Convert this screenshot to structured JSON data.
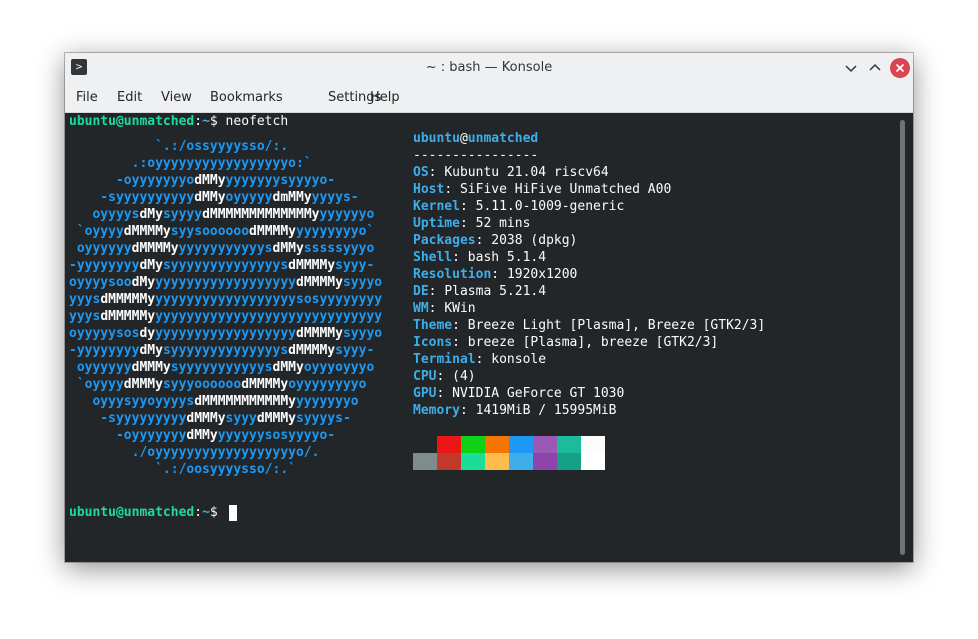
{
  "window": {
    "title": "~ : bash — Konsole",
    "app_icon": "terminal-icon",
    "controls": [
      "minimize-icon",
      "maximize-icon",
      "close-icon"
    ]
  },
  "menu": {
    "items": [
      {
        "label": "File"
      },
      {
        "label": "Edit"
      },
      {
        "label": "View"
      },
      {
        "label": "Bookmarks"
      },
      {
        "label": "Settings"
      },
      {
        "label": "Help"
      }
    ]
  },
  "terminal": {
    "prompt1": {
      "user_host": "ubuntu@unmatched",
      "sep": ":",
      "path": "~",
      "sigil": "$ ",
      "command": "neofetch"
    },
    "logo_lines": [
      [
        {
          "t": "           `.:/ossyyyysso/:.",
          "c": "b"
        }
      ],
      [
        {
          "t": "        .:oyyyyyyyyyyyyyyyyyo:`",
          "c": "b"
        }
      ],
      [
        {
          "t": "      -oyyyyyyyo",
          "c": "b"
        },
        {
          "t": "dMMy",
          "c": "w"
        },
        {
          "t": "yyyyyyysyyyyo-",
          "c": "b"
        }
      ],
      [
        {
          "t": "    -syyyyyyyyyy",
          "c": "b"
        },
        {
          "t": "dMMy",
          "c": "w"
        },
        {
          "t": "oyyyyy",
          "c": "b"
        },
        {
          "t": "dmMMy",
          "c": "w"
        },
        {
          "t": "yyyys-",
          "c": "b"
        }
      ],
      [
        {
          "t": "   oyyyys",
          "c": "b"
        },
        {
          "t": "dMy",
          "c": "w"
        },
        {
          "t": "syyyy",
          "c": "b"
        },
        {
          "t": "dMMMMMMMMMMMMMy",
          "c": "w"
        },
        {
          "t": "yyyyyyo",
          "c": "b"
        }
      ],
      [
        {
          "t": " `oyyyy",
          "c": "b"
        },
        {
          "t": "dMMMMy",
          "c": "w"
        },
        {
          "t": "syysoooooo",
          "c": "b"
        },
        {
          "t": "dMMMMy",
          "c": "w"
        },
        {
          "t": "yyyyyyyyo`",
          "c": "b"
        }
      ],
      [
        {
          "t": " oyyyyyy",
          "c": "b"
        },
        {
          "t": "dMMMMy",
          "c": "w"
        },
        {
          "t": "yyyyyyyyyyys",
          "c": "b"
        },
        {
          "t": "dMMy",
          "c": "w"
        },
        {
          "t": "sssssyyyo",
          "c": "b"
        }
      ],
      [
        {
          "t": "-yyyyyyyy",
          "c": "b"
        },
        {
          "t": "dMy",
          "c": "w"
        },
        {
          "t": "syyyyyyyyyyyyyys",
          "c": "b"
        },
        {
          "t": "dMMMMy",
          "c": "w"
        },
        {
          "t": "syyy-",
          "c": "b"
        }
      ],
      [
        {
          "t": "oyyyysoo",
          "c": "b"
        },
        {
          "t": "dMy",
          "c": "w"
        },
        {
          "t": "yyyyyyyyyyyyyyyyyy",
          "c": "b"
        },
        {
          "t": "dMMMMy",
          "c": "w"
        },
        {
          "t": "syyyo",
          "c": "b"
        }
      ],
      [
        {
          "t": "yyys",
          "c": "b"
        },
        {
          "t": "dMMMMMy",
          "c": "w"
        },
        {
          "t": "yyyyyyyyyyyyyyyyyysosyyyyyyyy",
          "c": "b"
        }
      ],
      [
        {
          "t": "yyys",
          "c": "b"
        },
        {
          "t": "dMMMMMy",
          "c": "w"
        },
        {
          "t": "yyyyyyyyyyyyyyyyyyyyyyyyyyyyy",
          "c": "b"
        }
      ],
      [
        {
          "t": "oyyyyysos",
          "c": "b"
        },
        {
          "t": "dy",
          "c": "w"
        },
        {
          "t": "yyyyyyyyyyyyyyyyyy",
          "c": "b"
        },
        {
          "t": "dMMMMy",
          "c": "w"
        },
        {
          "t": "syyyo",
          "c": "b"
        }
      ],
      [
        {
          "t": "-yyyyyyyy",
          "c": "b"
        },
        {
          "t": "dMy",
          "c": "w"
        },
        {
          "t": "syyyyyyyyyyyyyys",
          "c": "b"
        },
        {
          "t": "dMMMMy",
          "c": "w"
        },
        {
          "t": "syyy-",
          "c": "b"
        }
      ],
      [
        {
          "t": " oyyyyyy",
          "c": "b"
        },
        {
          "t": "dMMMy",
          "c": "w"
        },
        {
          "t": "syyyyyyyyyyys",
          "c": "b"
        },
        {
          "t": "dMMy",
          "c": "w"
        },
        {
          "t": "oyyyoyyyo",
          "c": "b"
        }
      ],
      [
        {
          "t": " `oyyyy",
          "c": "b"
        },
        {
          "t": "dMMMy",
          "c": "w"
        },
        {
          "t": "syyyoooooo",
          "c": "b"
        },
        {
          "t": "dMMMMy",
          "c": "w"
        },
        {
          "t": "oyyyyyyyyo",
          "c": "b"
        }
      ],
      [
        {
          "t": "   oyyysyyoyyyys",
          "c": "b"
        },
        {
          "t": "dMMMMMMMMMMMy",
          "c": "w"
        },
        {
          "t": "yyyyyyyo",
          "c": "b"
        }
      ],
      [
        {
          "t": "    -syyyyyyyyy",
          "c": "b"
        },
        {
          "t": "dMMMy",
          "c": "w"
        },
        {
          "t": "syyy",
          "c": "b"
        },
        {
          "t": "dMMMy",
          "c": "w"
        },
        {
          "t": "syyyys-",
          "c": "b"
        }
      ],
      [
        {
          "t": "      -oyyyyyyy",
          "c": "b"
        },
        {
          "t": "dMMy",
          "c": "w"
        },
        {
          "t": "yyyyyysosyyyyo-",
          "c": "b"
        }
      ],
      [
        {
          "t": "        ./oyyyyyyyyyyyyyyyyyyo/.",
          "c": "b"
        }
      ],
      [
        {
          "t": "           `.:/oosyyyysso/:.`",
          "c": "b"
        }
      ]
    ],
    "info": {
      "user": "ubuntu",
      "at": "@",
      "host": "unmatched",
      "separator": "----------------",
      "fields": [
        {
          "key": "OS",
          "value": "Kubuntu 21.04 riscv64"
        },
        {
          "key": "Host",
          "value": "SiFive HiFive Unmatched A00"
        },
        {
          "key": "Kernel",
          "value": "5.11.0-1009-generic"
        },
        {
          "key": "Uptime",
          "value": "52 mins"
        },
        {
          "key": "Packages",
          "value": "2038 (dpkg)"
        },
        {
          "key": "Shell",
          "value": "bash 5.1.4"
        },
        {
          "key": "Resolution",
          "value": "1920x1200"
        },
        {
          "key": "DE",
          "value": "Plasma 5.21.4"
        },
        {
          "key": "WM",
          "value": "KWin"
        },
        {
          "key": "Theme",
          "value": "Breeze Light [Plasma], Breeze [GTK2/3]"
        },
        {
          "key": "Icons",
          "value": "breeze [Plasma], breeze [GTK2/3]"
        },
        {
          "key": "Terminal",
          "value": "konsole"
        },
        {
          "key": "CPU",
          "value": "(4)"
        },
        {
          "key": "GPU",
          "value": "NVIDIA GeForce GT 1030"
        },
        {
          "key": "Memory",
          "value": "1419MiB / 15995MiB"
        }
      ]
    },
    "palette": {
      "row1": [
        "#232627",
        "#ed1515",
        "#11d116",
        "#f67400",
        "#1d99f3",
        "#9b59b6",
        "#1abc9c",
        "#fcfcfc"
      ],
      "row2": [
        "#7f8c8d",
        "#c0392b",
        "#1cdc9a",
        "#fdbc4b",
        "#3daee9",
        "#8e44ad",
        "#16a085",
        "#ffffff"
      ]
    },
    "prompt2": {
      "user_host": "ubuntu@unmatched",
      "sep": ":",
      "path": "~",
      "sigil": "$ "
    }
  },
  "colors": {
    "terminal_bg": "#232629",
    "prompt_green": "#1cdc9a",
    "info_blue": "#3daee9",
    "logo_blue": "#1d99f3",
    "text": "#fcfcfc",
    "titlebar_bg": "#eff0f1",
    "close_red": "#da4453"
  }
}
